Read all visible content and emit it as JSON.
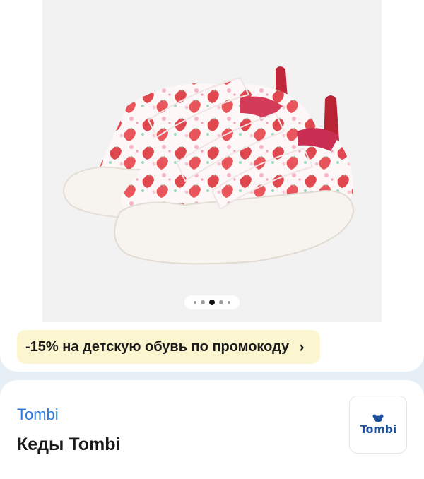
{
  "gallery": {
    "image_alt": "Кеды Tombi",
    "dots_count": 5,
    "active_index": 2
  },
  "promo": {
    "text": "-15% на детскую обувь по промокоду",
    "chevron": "›",
    "background": "#fbf6cf"
  },
  "product": {
    "brand": "Tombi",
    "title": "Кеды Tombi",
    "brand_logo_text": "Tombi",
    "brand_color": "#2d7ae0"
  }
}
